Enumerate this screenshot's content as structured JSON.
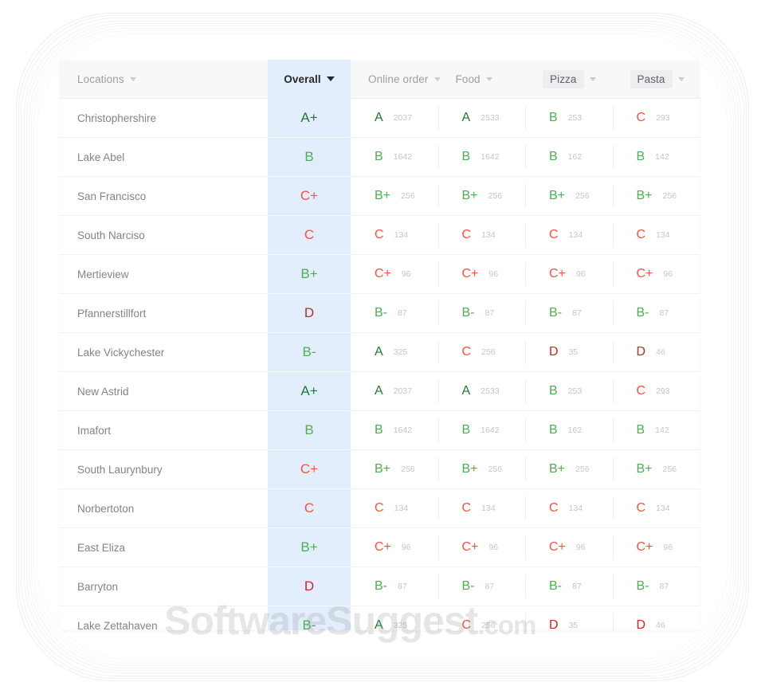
{
  "watermark": {
    "brand": "SoftwareSuggest",
    "suffix": ".com"
  },
  "table": {
    "columns": [
      {
        "key": "locations",
        "label": "Locations",
        "style": "plain",
        "active": false,
        "has_caret": true
      },
      {
        "key": "overall",
        "label": "Overall",
        "style": "active",
        "active": true,
        "has_caret": true
      },
      {
        "key": "online_order",
        "label": "Online order",
        "style": "plain",
        "active": false,
        "has_caret": true
      },
      {
        "key": "food",
        "label": "Food",
        "style": "plain",
        "active": false,
        "has_caret": true
      },
      {
        "key": "pizza",
        "label": "Pizza",
        "style": "pill",
        "active": false,
        "has_caret": true
      },
      {
        "key": "pasta",
        "label": "Pasta",
        "style": "pill",
        "active": false,
        "has_caret": true
      }
    ],
    "rows": [
      {
        "location": "Christophershire",
        "overall": "A+",
        "overall_color": "g-a",
        "cells": [
          {
            "grade": "A",
            "count": "2037",
            "color": "g-a"
          },
          {
            "grade": "A",
            "count": "2533",
            "color": "g-a"
          },
          {
            "grade": "B",
            "count": "253",
            "color": "g-b"
          },
          {
            "grade": "C",
            "count": "293",
            "color": "g-c"
          }
        ]
      },
      {
        "location": "Lake Abel",
        "overall": "B",
        "overall_color": "g-b",
        "cells": [
          {
            "grade": "B",
            "count": "1642",
            "color": "g-b"
          },
          {
            "grade": "B",
            "count": "1642",
            "color": "g-b"
          },
          {
            "grade": "B",
            "count": "162",
            "color": "g-b"
          },
          {
            "grade": "B",
            "count": "142",
            "color": "g-b"
          }
        ]
      },
      {
        "location": "San Francisco",
        "overall": "C+",
        "overall_color": "g-c",
        "cells": [
          {
            "grade": "B+",
            "count": "256",
            "color": "g-b"
          },
          {
            "grade": "B+",
            "count": "256",
            "color": "g-b"
          },
          {
            "grade": "B+",
            "count": "256",
            "color": "g-b"
          },
          {
            "grade": "B+",
            "count": "256",
            "color": "g-b"
          }
        ]
      },
      {
        "location": "South Narciso",
        "overall": "C",
        "overall_color": "g-c",
        "cells": [
          {
            "grade": "C",
            "count": "134",
            "color": "g-c"
          },
          {
            "grade": "C",
            "count": "134",
            "color": "g-c"
          },
          {
            "grade": "C",
            "count": "134",
            "color": "g-c"
          },
          {
            "grade": "C",
            "count": "134",
            "color": "g-c"
          }
        ]
      },
      {
        "location": "Mertieview",
        "overall": "B+",
        "overall_color": "g-b",
        "cells": [
          {
            "grade": "C+",
            "count": "96",
            "color": "g-c"
          },
          {
            "grade": "C+",
            "count": "96",
            "color": "g-c"
          },
          {
            "grade": "C+",
            "count": "96",
            "color": "g-c"
          },
          {
            "grade": "C+",
            "count": "96",
            "color": "g-c"
          }
        ]
      },
      {
        "location": "Pfannerstillfort",
        "overall": "D",
        "overall_color": "g-d",
        "cells": [
          {
            "grade": "B-",
            "count": "87",
            "color": "g-b"
          },
          {
            "grade": "B-",
            "count": "87",
            "color": "g-b"
          },
          {
            "grade": "B-",
            "count": "87",
            "color": "g-b"
          },
          {
            "grade": "B-",
            "count": "87",
            "color": "g-b"
          }
        ]
      },
      {
        "location": "Lake Vickychester",
        "overall": "B-",
        "overall_color": "g-b",
        "cells": [
          {
            "grade": "A",
            "count": "325",
            "color": "g-a"
          },
          {
            "grade": "C",
            "count": "256",
            "color": "g-c"
          },
          {
            "grade": "D",
            "count": "35",
            "color": "g-d"
          },
          {
            "grade": "D",
            "count": "46",
            "color": "g-d"
          }
        ]
      },
      {
        "location": "New Astrid",
        "overall": "A+",
        "overall_color": "g-a",
        "cells": [
          {
            "grade": "A",
            "count": "2037",
            "color": "g-a"
          },
          {
            "grade": "A",
            "count": "2533",
            "color": "g-a"
          },
          {
            "grade": "B",
            "count": "253",
            "color": "g-b"
          },
          {
            "grade": "C",
            "count": "293",
            "color": "g-c"
          }
        ]
      },
      {
        "location": "Imafort",
        "overall": "B",
        "overall_color": "g-b",
        "cells": [
          {
            "grade": "B",
            "count": "1642",
            "color": "g-b"
          },
          {
            "grade": "B",
            "count": "1642",
            "color": "g-b"
          },
          {
            "grade": "B",
            "count": "162",
            "color": "g-b"
          },
          {
            "grade": "B",
            "count": "142",
            "color": "g-b"
          }
        ]
      },
      {
        "location": "South Laurynbury",
        "overall": "C+",
        "overall_color": "g-c",
        "cells": [
          {
            "grade": "B+",
            "count": "256",
            "color": "g-b"
          },
          {
            "grade": "B+",
            "count": "256",
            "color": "g-b"
          },
          {
            "grade": "B+",
            "count": "256",
            "color": "g-b"
          },
          {
            "grade": "B+",
            "count": "256",
            "color": "g-b"
          }
        ]
      },
      {
        "location": "Norbertoton",
        "overall": "C",
        "overall_color": "g-c",
        "cells": [
          {
            "grade": "C",
            "count": "134",
            "color": "g-c"
          },
          {
            "grade": "C",
            "count": "134",
            "color": "g-c"
          },
          {
            "grade": "C",
            "count": "134",
            "color": "g-c"
          },
          {
            "grade": "C",
            "count": "134",
            "color": "g-c"
          }
        ]
      },
      {
        "location": "East Eliza",
        "overall": "B+",
        "overall_color": "g-b",
        "cells": [
          {
            "grade": "C+",
            "count": "96",
            "color": "g-c"
          },
          {
            "grade": "C+",
            "count": "96",
            "color": "g-c"
          },
          {
            "grade": "C+",
            "count": "96",
            "color": "g-c"
          },
          {
            "grade": "C+",
            "count": "96",
            "color": "g-c"
          }
        ]
      },
      {
        "location": "Barryton",
        "overall": "D",
        "overall_color": "g-d",
        "cells": [
          {
            "grade": "B-",
            "count": "87",
            "color": "g-b"
          },
          {
            "grade": "B-",
            "count": "87",
            "color": "g-b"
          },
          {
            "grade": "B-",
            "count": "87",
            "color": "g-b"
          },
          {
            "grade": "B-",
            "count": "87",
            "color": "g-b"
          }
        ]
      },
      {
        "location": "Lake Zettahaven",
        "overall": "B-",
        "overall_color": "g-b",
        "cells": [
          {
            "grade": "A",
            "count": "325",
            "color": "g-a"
          },
          {
            "grade": "C",
            "count": "256",
            "color": "g-c"
          },
          {
            "grade": "D",
            "count": "35",
            "color": "g-d"
          },
          {
            "grade": "D",
            "count": "46",
            "color": "g-d"
          }
        ]
      }
    ]
  },
  "colors": {
    "grade_a": "#1f7a33",
    "grade_b": "#4caf50",
    "grade_c": "#ff4d42",
    "grade_d": "#c62828",
    "overall_highlight": "#e2eefb",
    "header_bg": "#f8f8f8"
  }
}
